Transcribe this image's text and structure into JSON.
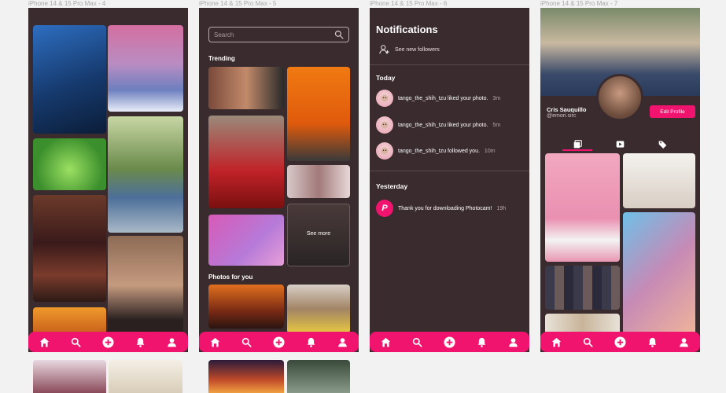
{
  "frames": [
    {
      "label": "iPhone 14 & 15 Pro Max - 4"
    },
    {
      "label": "iPhone 14 & 15 Pro Max - 5"
    },
    {
      "label": "iPhone 14 & 15 Pro Max - 6"
    },
    {
      "label": "iPhone 14 & 15 Pro Max - 7"
    }
  ],
  "navbar": {
    "icons": [
      "home-icon",
      "search-icon",
      "add-icon",
      "bell-icon",
      "user-icon"
    ]
  },
  "search": {
    "placeholder": "Search"
  },
  "explore": {
    "trending_heading": "Trending",
    "see_more": "See more",
    "photos_for_you_heading": "Photos for you"
  },
  "notifications": {
    "title": "Notifications",
    "see_new_followers": "See new followers",
    "today_heading": "Today",
    "today": [
      {
        "text": "tango_the_shih_tzu liked your photo.",
        "time": "3m"
      },
      {
        "text": "tango_the_shih_tzu liked your photo.",
        "time": "5m"
      },
      {
        "text": "tango_the_shih_tzu followed you.",
        "time": "10m"
      }
    ],
    "yesterday_heading": "Yesterday",
    "yesterday": [
      {
        "text": "Thank you for downloading Photocam!",
        "time": "19h"
      }
    ]
  },
  "profile": {
    "name": "Cris Sauquillo",
    "handle": "@emori.sirc",
    "edit_button": "Edit Profile",
    "tabs": [
      "photos-tab-icon",
      "videos-tab-icon",
      "tagged-tab-icon"
    ]
  },
  "colors": {
    "accent": "#f0146e",
    "screen_bg": "#3a2b2f",
    "canvas_bg": "#f2f2f2"
  }
}
